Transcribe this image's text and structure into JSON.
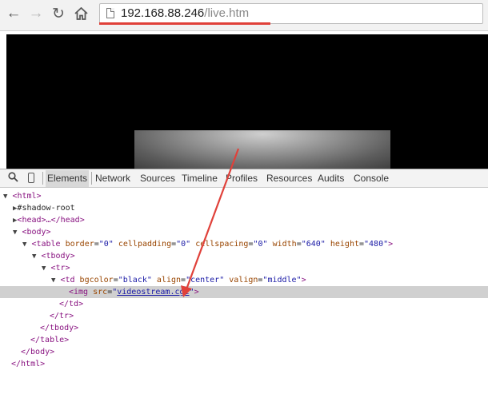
{
  "browser": {
    "url_host": "192.168.88.246",
    "url_path": "/live.htm",
    "back_icon": "arrow-left-icon",
    "forward_icon": "arrow-right-icon",
    "reload_icon": "reload-icon",
    "home_icon": "home-icon",
    "page_icon": "page-icon"
  },
  "devtools": {
    "search_icon": "search-icon",
    "device_icon": "mobile-device-icon",
    "tabs": [
      "Elements",
      "Network",
      "Sources",
      "Timeline",
      "Profiles",
      "Resources",
      "Audits",
      "Console"
    ],
    "active_tab": "Elements",
    "dom": {
      "html_open": "<html>",
      "shadow_root": "#shadow-root",
      "head": "<head>…</head>",
      "body_open": "<body>",
      "table_open_tag": "<table",
      "table_attrs": [
        {
          "name": "border",
          "value": "\"0\""
        },
        {
          "name": "cellpadding",
          "value": "\"0\""
        },
        {
          "name": "cellspacing",
          "value": "\"0\""
        },
        {
          "name": "width",
          "value": "\"640\""
        },
        {
          "name": "height",
          "value": "\"480\""
        }
      ],
      "tbody_open": "<tbody>",
      "tr_open": "<tr>",
      "td_open_tag": "<td",
      "td_attrs": [
        {
          "name": "bgcolor",
          "value": "\"black\""
        },
        {
          "name": "align",
          "value": "\"center\""
        },
        {
          "name": "valign",
          "value": "\"middle\""
        }
      ],
      "img_open_tag": "<img",
      "img_attr_name": "src",
      "img_attr_value": "videostream.cgi",
      "td_close": "</td>",
      "tr_close": "</tr>",
      "tbody_close": "</tbody>",
      "table_close": "</table>",
      "body_close": "</body>",
      "html_close": "</html>"
    }
  },
  "colors": {
    "annotation": "#e0413a",
    "tag": "#881280",
    "attribute_name": "#994500",
    "attribute_value": "#1a1aa6"
  }
}
